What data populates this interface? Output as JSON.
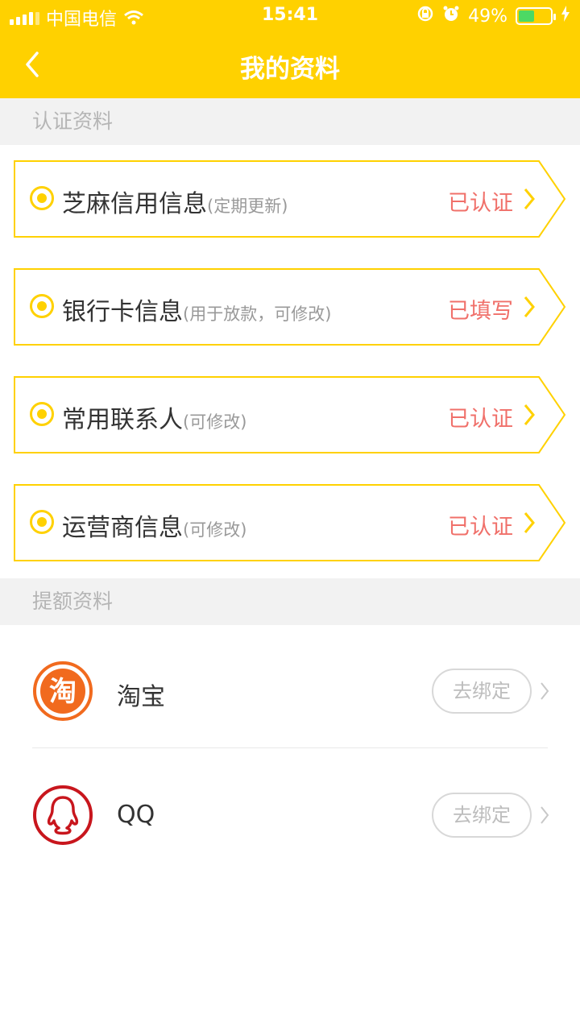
{
  "status_bar": {
    "carrier": "中国电信",
    "time": "15:41",
    "battery_text": "49%",
    "battery_level": 0.49
  },
  "nav": {
    "title": "我的资料",
    "back_icon": "chevron-left-icon"
  },
  "sections": {
    "verify_header": "认证资料",
    "quota_header": "提额资料"
  },
  "cards": [
    {
      "title": "芝麻信用信息",
      "sub": "(定期更新)",
      "status": "已认证"
    },
    {
      "title": "银行卡信息",
      "sub": "(用于放款，可修改)",
      "status": "已填写"
    },
    {
      "title": "常用联系人",
      "sub": "(可修改)",
      "status": "已认证"
    },
    {
      "title": "运营商信息",
      "sub": "(可修改)",
      "status": "已认证"
    }
  ],
  "bindings": [
    {
      "name": "淘宝",
      "logo_char": "淘",
      "button": "去绑定",
      "icon": "taobao-icon"
    },
    {
      "name": "QQ",
      "button": "去绑定",
      "icon": "qq-icon"
    }
  ],
  "colors": {
    "brand": "#FFD100",
    "status_red": "#F0706A",
    "taobao": "#F16A1E",
    "qq": "#C8161D"
  }
}
